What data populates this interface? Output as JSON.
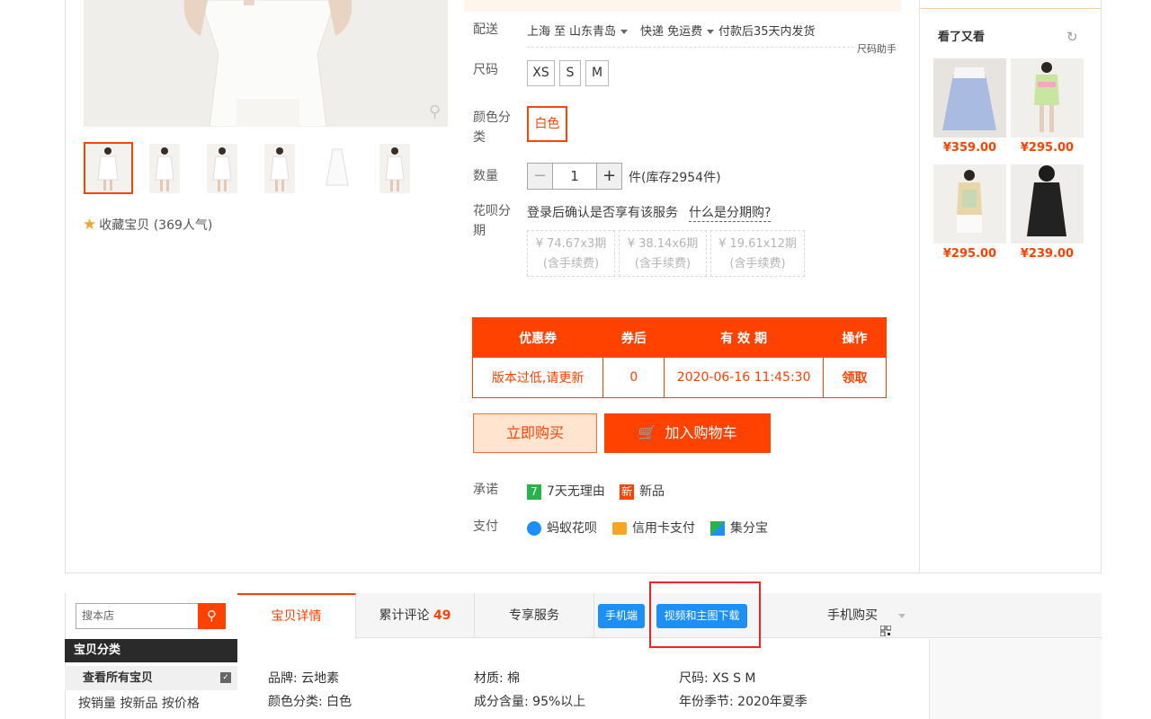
{
  "gallery": {
    "favorite_label": "收藏宝贝 (369人气)"
  },
  "delivery": {
    "label": "配送",
    "from": "上海 至",
    "to": "山东青岛",
    "shipping": "快递 免运费",
    "ship_time": "付款后35天内发货",
    "size_helper": "尺码助手"
  },
  "size": {
    "label": "尺码",
    "options": [
      "XS",
      "S",
      "M"
    ]
  },
  "color": {
    "label": "颜色分类",
    "label_line1": "颜色分",
    "label_line2": "类",
    "selected": "白色"
  },
  "quantity": {
    "label": "数量",
    "value": "1",
    "minus": "−",
    "plus": "+",
    "stock": "件(库存2954件)"
  },
  "installment": {
    "label_line1": "花呗分",
    "label_line2": "期",
    "login_text": "登录后确认是否享有该服务",
    "what_is": "什么是分期购?",
    "plans": [
      {
        "amount": "¥ 74.67x3期",
        "fee": "(含手续费)"
      },
      {
        "amount": "¥ 38.14x6期",
        "fee": "(含手续费)"
      },
      {
        "amount": "¥ 19.61x12期",
        "fee": "(含手续费)"
      }
    ]
  },
  "coupon_table": {
    "headers": [
      "优惠券",
      "券后",
      "有 效 期",
      "操作"
    ],
    "row": [
      "版本过低,请更新",
      "0",
      "2020-06-16 11:45:30",
      "领取"
    ]
  },
  "actions": {
    "buy_now": "立即购买",
    "add_to_cart": "加入购物车"
  },
  "promise": {
    "label": "承诺",
    "items": [
      {
        "badge": "7",
        "text": "7天无理由",
        "color": "#2bb24c"
      },
      {
        "badge": "新",
        "text": "新品",
        "color": "#ff4200"
      }
    ]
  },
  "payment": {
    "label": "支付",
    "items": [
      "蚂蚁花呗",
      "信用卡支付",
      "集分宝"
    ]
  },
  "recommend": {
    "title": "看了又看",
    "prices": [
      "¥359.00",
      "¥295.00",
      "¥295.00",
      "¥239.00"
    ]
  },
  "shop": {
    "search_placeholder": "搜本店",
    "category_title": "宝贝分类",
    "view_all": "查看所有宝贝",
    "sorts": "按销量 按新品 按价格"
  },
  "tabs": {
    "details": "宝贝详情",
    "reviews_label": "累计评论",
    "reviews_count": "49",
    "services": "专享服务",
    "mobile": "手机端",
    "download": "视频和主图下载",
    "mobile_buy": "手机购买"
  },
  "attributes": [
    "品牌: 云地素",
    "材质: 棉",
    "尺码: XS S M",
    "颜色分类: 白色",
    "成分含量: 95%以上",
    "年份季节: 2020年夏季"
  ],
  "colors": {
    "accent": "#ff4200",
    "blue": "#1c90f5"
  }
}
